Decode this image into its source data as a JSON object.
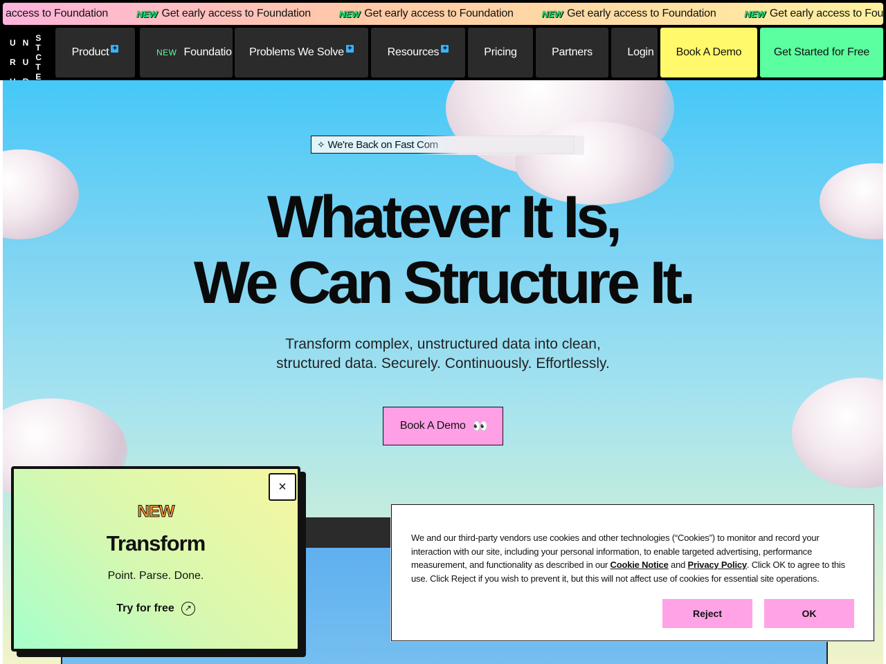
{
  "ticker": {
    "partial": "access to Foundation",
    "badge": "NEW",
    "text": "Get early access to Foundation"
  },
  "nav": {
    "logo_letters": [
      "U",
      "N",
      "S",
      "T",
      "R",
      "U",
      "C",
      "T",
      "U",
      "R",
      "E",
      "D"
    ],
    "product": "Product",
    "foundation_badge": "NEW",
    "foundation": "Foundation",
    "problems": "Problems We Solve",
    "resources": "Resources",
    "pricing": "Pricing",
    "partners": "Partners",
    "login": "Login",
    "book_demo": "Book A Demo",
    "get_started": "Get Started for Free"
  },
  "hero": {
    "badge_text": "We're Back on Fast Com",
    "headline_1": "Whatever It Is,",
    "headline_2": "We Can Structure It.",
    "sub_1": "Transform complex, unstructured data into clean,",
    "sub_2": "structured data. Securely. Continuously. Effortlessly.",
    "cta": "Book A Demo",
    "cta_emoji": "👀"
  },
  "promo": {
    "close": "×",
    "new": "NEW",
    "title": "Transform",
    "subtitle": "Point. Parse. Done.",
    "try": "Try for free",
    "try_icon": "↗"
  },
  "cookie": {
    "text_1": "We and our third-party vendors use cookies and other technologies (“Cookies”) to monitor and record your interaction with our site, including your personal information, to enable targeted advertising, performance measurement, and functionality as described in our ",
    "cookie_notice": "Cookie Notice",
    "and": " and ",
    "privacy_policy": "Privacy Policy",
    "text_2": ". Click OK to agree to this use. Click Reject if you wish to prevent it, but this will not affect use of cookies for essential site operations.",
    "reject": "Reject",
    "ok": "OK"
  },
  "colors": {
    "ticker_gradient_start": "#ffb3dc",
    "ticker_gradient_end": "#fff1a0",
    "book_demo_bg": "#fff96b",
    "get_started_bg": "#5bff9f",
    "plus_icon": "#39b3ff",
    "cta_pink": "#ff9fe6",
    "sky_top": "#46c8f7"
  }
}
